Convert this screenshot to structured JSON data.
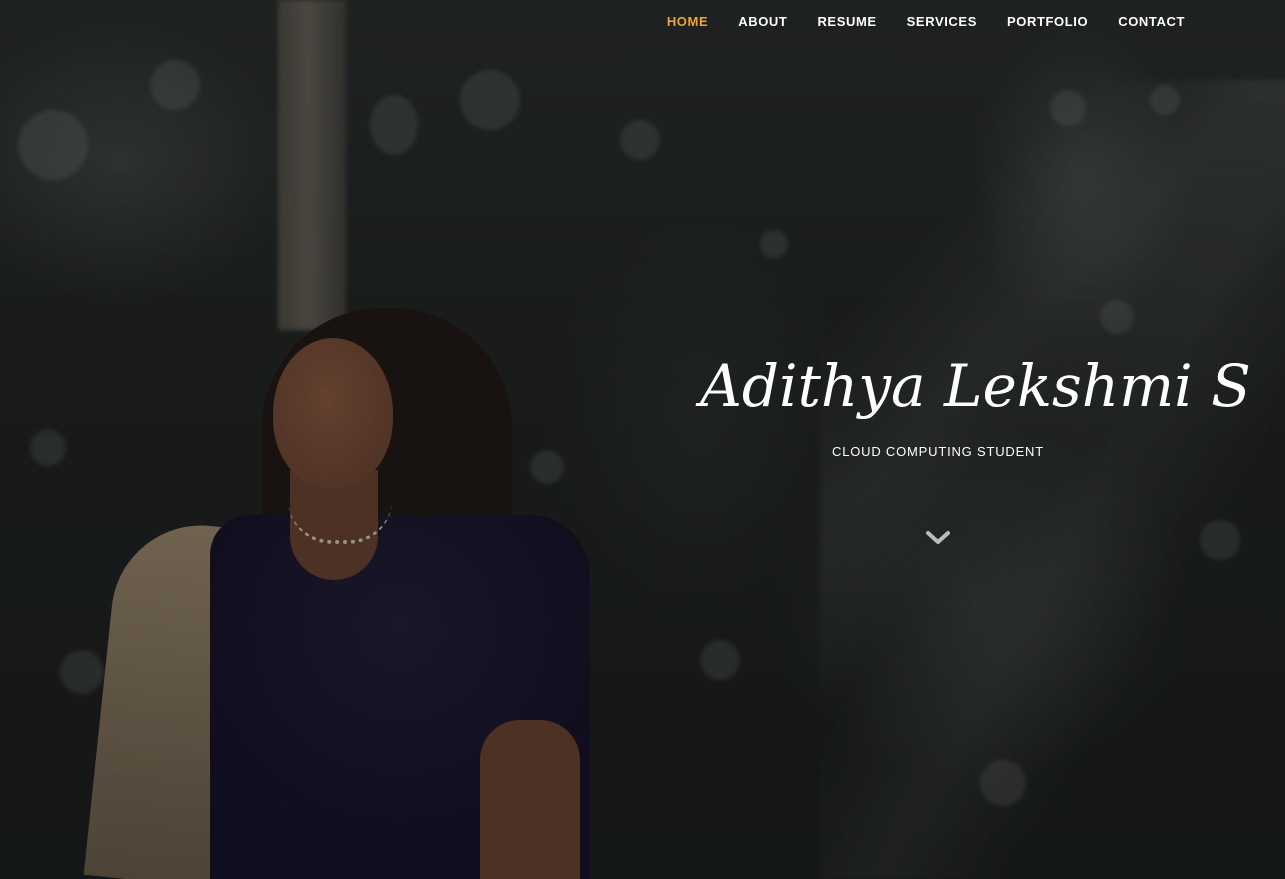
{
  "nav": {
    "items": [
      {
        "label": "HOME",
        "active": true
      },
      {
        "label": "ABOUT",
        "active": false
      },
      {
        "label": "RESUME",
        "active": false
      },
      {
        "label": "SERVICES",
        "active": false
      },
      {
        "label": "PORTFOLIO",
        "active": false
      },
      {
        "label": "CONTACT",
        "active": false
      }
    ],
    "active_color": "#f0a52c",
    "text_color": "#ffffff"
  },
  "hero": {
    "name": "Adithya Lekshmi S",
    "tagline": "CLOUD COMPUTING STUDENT",
    "scroll_icon": "chevron-down-icon"
  }
}
